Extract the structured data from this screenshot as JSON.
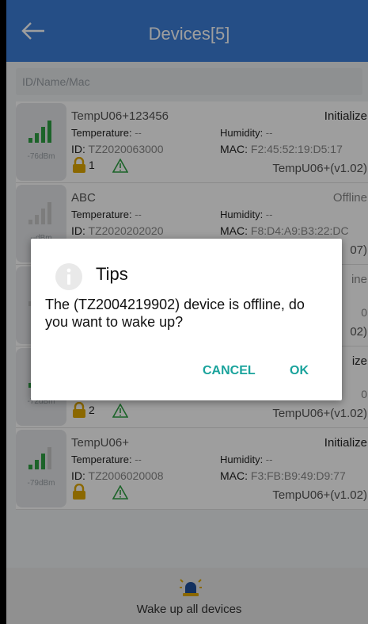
{
  "header": {
    "title": "Devices[5]"
  },
  "search": {
    "placeholder": "ID/Name/Mac"
  },
  "devices": [
    {
      "rssi": "-76dBm",
      "name": "TempU06+123456",
      "status": "Initialize",
      "temperature_label": "Temperature:",
      "temperature": " --",
      "humidity_label": "Humidity:",
      "humidity": " --",
      "id_label": "ID:",
      "id": " TZ2020063000",
      "mac_label": "MAC:",
      "mac": " F2:45:52:19:D5:17",
      "lock_count": "1",
      "model": "TempU06+(v1.02)",
      "signal_level": 4
    },
    {
      "rssi": "--dBm",
      "name": "ABC",
      "status": "Offline",
      "temperature_label": "Temperature:",
      "temperature": " --",
      "humidity_label": "Humidity:",
      "humidity": " --",
      "id_label": "ID:",
      "id": " TZ2020202020",
      "mac_label": "MAC:",
      "mac": " F8:D4:A9:B3:22:DC",
      "lock_count": "",
      "model": "",
      "model_tail": "07)",
      "signal_level": 0
    },
    {
      "rssi": "--d",
      "name": "",
      "status": "",
      "status_tail": "ine",
      "mac_tail": "0",
      "model_tail": "02)",
      "signal_level": 0
    },
    {
      "rssi": "-72dBm",
      "name": "",
      "status": "",
      "status_tail": "ize",
      "mac_tail": "0",
      "lock_count": "2",
      "model": "TempU06+(v1.02)",
      "signal_level": 2
    },
    {
      "rssi": "-79dBm",
      "name": "TempU06+",
      "status": "Initialize",
      "temperature_label": "Temperature:",
      "temperature": " --",
      "humidity_label": "Humidity:",
      "humidity": " --",
      "id_label": "ID:",
      "id": " TZ2006020008",
      "mac_label": "MAC:",
      "mac": " F3:FB:B9:49:D9:77",
      "lock_count": "",
      "model": "TempU06+(v1.02)",
      "signal_level": 3
    }
  ],
  "dialog": {
    "title": "Tips",
    "message": "The (TZ2004219902) device is offline, do you want to wake up?",
    "cancel_label": "CANCEL",
    "ok_label": "OK"
  },
  "footer": {
    "wake_label": "Wake up all devices"
  },
  "colors": {
    "appbar": "#3d7fd8",
    "accent": "#1aa39c",
    "signal": "#2ea043",
    "lock": "#e0a800"
  }
}
